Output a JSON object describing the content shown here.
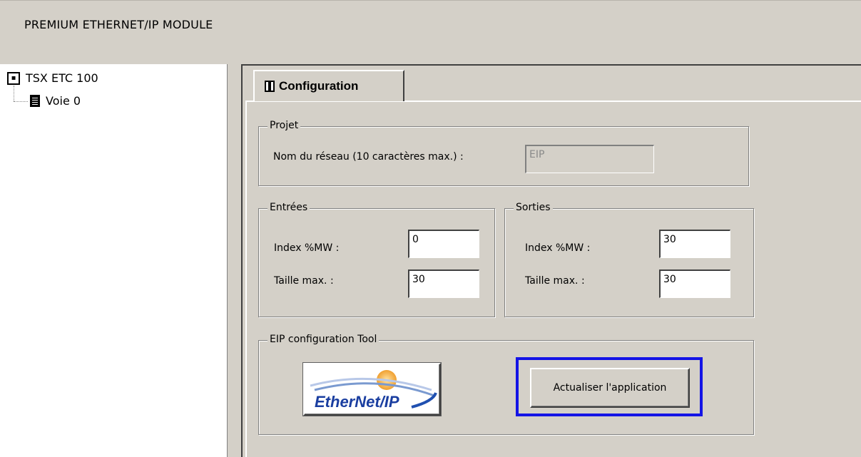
{
  "window": {
    "title": "PREMIUM ETHERNET/IP MODULE"
  },
  "tree": {
    "root": {
      "label": "TSX ETC 100",
      "icon": "module-icon"
    },
    "child": {
      "label": "Voie 0",
      "icon": "document-icon"
    }
  },
  "tabs": [
    {
      "label": "Configuration",
      "icon": "config-icon",
      "selected": true
    }
  ],
  "projet": {
    "legend": "Projet",
    "network_name_label": "Nom du réseau (10 caractères max.) :",
    "network_name_value": "EIP"
  },
  "entrees": {
    "legend": "Entrées",
    "index_label": "Index %MW :",
    "index_value": "0",
    "size_label": "Taille max. :",
    "size_value": "30"
  },
  "sorties": {
    "legend": "Sorties",
    "index_label": "Index %MW :",
    "index_value": "30",
    "size_label": "Taille max. :",
    "size_value": "30"
  },
  "eip_tool": {
    "legend": "EIP configuration Tool",
    "logo_text": "EtherNet/IP",
    "update_button": "Actualiser l'application",
    "highlight_color": "#1414e6"
  }
}
